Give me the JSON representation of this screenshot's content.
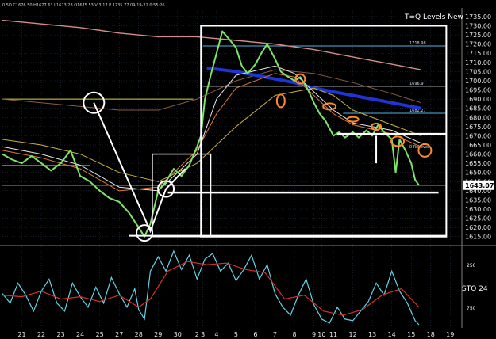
{
  "header": {
    "info": "0.5D  C1676.50 H1677.63 L1673.28 O1675.53 V 3.17 P 1735.77 09-19-22 0:55:26",
    "title": "T=Q Levels New"
  },
  "colors": {
    "background": "#000000",
    "grid": "#26364a",
    "price": "#7fe36b",
    "ma_blue": "#1f33d6",
    "ma_pink": "#d48b8b",
    "ma_brown": "#8a5a45",
    "ma_gold": "#c8b23c",
    "ma_white": "#e8e8e8",
    "ma_orange": "#e07a33",
    "level_cyan": "#4fb6e6",
    "level_yellow": "#d6d64a",
    "level_red": "#d93c3c",
    "sto_fast": "#5fd6e6",
    "sto_slow": "#d83030",
    "annotation": "#ffffff",
    "highlight_circle": "#ff8a2a"
  },
  "chart_data": [
    {
      "type": "line",
      "title": "T=Q Levels New",
      "ylim": [
        1611,
        1738
      ],
      "y_ticks": [
        "1735.00",
        "1730.00",
        "1725.00",
        "1720.00",
        "1715.00",
        "1710.00",
        "1705.00",
        "1700.00",
        "1695.00",
        "1690.00",
        "1685.00",
        "1680.00",
        "1675.00",
        "1670.00",
        "1665.00",
        "1660.00",
        "1655.00",
        "1650.00",
        "1645.00",
        "1640.00",
        "1635.00",
        "1630.00",
        "1625.00",
        "1620.00",
        "1615.00"
      ],
      "x_ticks": [
        "21",
        "22",
        "23",
        "24",
        "25",
        "27",
        "28",
        "29",
        "30",
        "2",
        "3",
        "4",
        "5",
        "6",
        "7",
        "8",
        "9",
        "10",
        "11",
        "12",
        "13",
        "14",
        "15",
        "18",
        "19"
      ],
      "x_tick_positions": [
        21,
        22,
        23,
        24,
        25,
        26,
        27,
        28,
        29,
        30,
        30.3,
        31,
        32,
        33,
        34,
        35,
        36,
        36.4,
        37,
        38,
        39,
        40,
        41,
        42,
        43
      ],
      "last_price_label": "1643.07",
      "level_labels": [
        {
          "text": "1718.98",
          "price": 1718.98
        },
        {
          "text": "1696.9",
          "price": 1696.9
        },
        {
          "text": "1682.27",
          "price": 1682.27
        },
        {
          "text": "0 Rollover",
          "price": 1662.5
        }
      ],
      "series": [
        {
          "key": "price",
          "points": [
            [
              20.0,
              1660
            ],
            [
              20.5,
              1657
            ],
            [
              21.0,
              1655
            ],
            [
              21.5,
              1659
            ],
            [
              22.0,
              1655
            ],
            [
              22.5,
              1651
            ],
            [
              23.0,
              1655
            ],
            [
              23.5,
              1662
            ],
            [
              24.0,
              1648
            ],
            [
              24.5,
              1645
            ],
            [
              25.0,
              1640
            ],
            [
              25.5,
              1636
            ],
            [
              26.0,
              1634
            ],
            [
              26.5,
              1628
            ],
            [
              27.0,
              1620
            ],
            [
              27.3,
              1615
            ],
            [
              27.6,
              1622
            ],
            [
              28.0,
              1640
            ],
            [
              28.4,
              1645
            ],
            [
              28.8,
              1652
            ],
            [
              29.2,
              1648
            ],
            [
              29.6,
              1654
            ],
            [
              30.0,
              1664
            ],
            [
              30.2,
              1670
            ],
            [
              30.4,
              1690
            ],
            [
              30.7,
              1703
            ],
            [
              31.0,
              1715
            ],
            [
              31.3,
              1727
            ],
            [
              31.7,
              1722
            ],
            [
              32.0,
              1718
            ],
            [
              32.3,
              1708
            ],
            [
              32.6,
              1704
            ],
            [
              33.0,
              1709
            ],
            [
              33.3,
              1715
            ],
            [
              33.6,
              1720
            ],
            [
              34.0,
              1712
            ],
            [
              34.3,
              1705
            ],
            [
              34.7,
              1702
            ],
            [
              35.0,
              1700
            ],
            [
              35.3,
              1702
            ],
            [
              35.7,
              1695
            ],
            [
              36.0,
              1688
            ],
            [
              36.3,
              1682
            ],
            [
              36.6,
              1678
            ],
            [
              37.0,
              1670
            ],
            [
              37.3,
              1672
            ],
            [
              37.6,
              1669
            ],
            [
              38.0,
              1672
            ],
            [
              38.3,
              1669
            ],
            [
              38.7,
              1673
            ],
            [
              39.0,
              1670
            ],
            [
              39.3,
              1676
            ],
            [
              39.6,
              1672
            ],
            [
              40.0,
              1668
            ],
            [
              40.2,
              1650
            ],
            [
              40.4,
              1668
            ],
            [
              40.7,
              1662
            ],
            [
              41.0,
              1655
            ],
            [
              41.2,
              1646
            ],
            [
              41.4,
              1643
            ]
          ]
        },
        {
          "key": "ma_blue",
          "points": [
            [
              30.5,
              1707
            ],
            [
              32,
              1705
            ],
            [
              33,
              1703
            ],
            [
              34,
              1701
            ],
            [
              35,
              1699
            ],
            [
              36,
              1696
            ],
            [
              37,
              1694
            ],
            [
              38,
              1692
            ],
            [
              39,
              1690
            ],
            [
              40,
              1688
            ],
            [
              41,
              1686
            ],
            [
              41.5,
              1685
            ]
          ]
        },
        {
          "key": "ma_pink",
          "points": [
            [
              20,
              1733
            ],
            [
              22,
              1731
            ],
            [
              24,
              1729
            ],
            [
              26,
              1726
            ],
            [
              28,
              1724
            ],
            [
              30,
              1724
            ],
            [
              32,
              1722
            ],
            [
              34,
              1720
            ],
            [
              36,
              1717
            ],
            [
              38,
              1713
            ],
            [
              40,
              1709
            ],
            [
              41.5,
              1706
            ]
          ]
        },
        {
          "key": "ma_brown",
          "points": [
            [
              20,
              1690
            ],
            [
              22,
              1688
            ],
            [
              24,
              1686
            ],
            [
              26,
              1684
            ],
            [
              28,
              1684
            ],
            [
              30,
              1690
            ],
            [
              32,
              1700
            ],
            [
              34,
              1706
            ],
            [
              36,
              1704
            ],
            [
              38,
              1699
            ],
            [
              40,
              1693
            ],
            [
              41.5,
              1688
            ]
          ]
        },
        {
          "key": "ma_gold",
          "points": [
            [
              20,
              1668
            ],
            [
              22,
              1665
            ],
            [
              24,
              1660
            ],
            [
              26,
              1650
            ],
            [
              28,
              1645
            ],
            [
              30,
              1655
            ],
            [
              32,
              1675
            ],
            [
              34,
              1692
            ],
            [
              36,
              1696
            ],
            [
              37,
              1692
            ],
            [
              38,
              1684
            ],
            [
              40,
              1676
            ],
            [
              41.5,
              1670
            ]
          ]
        },
        {
          "key": "ma_white",
          "points": [
            [
              20,
              1664
            ],
            [
              22,
              1660
            ],
            [
              24,
              1654
            ],
            [
              26,
              1642
            ],
            [
              28,
              1640
            ],
            [
              30,
              1660
            ],
            [
              31,
              1690
            ],
            [
              32,
              1703
            ],
            [
              34,
              1708
            ],
            [
              35,
              1704
            ],
            [
              36,
              1694
            ],
            [
              37,
              1684
            ],
            [
              38,
              1677
            ],
            [
              40,
              1673
            ],
            [
              41.5,
              1666
            ]
          ]
        },
        {
          "key": "ma_orange",
          "points": [
            [
              20,
              1662
            ],
            [
              22,
              1658
            ],
            [
              24,
              1652
            ],
            [
              26,
              1640
            ],
            [
              28,
              1642
            ],
            [
              30,
              1662
            ],
            [
              31,
              1682
            ],
            [
              32,
              1696
            ],
            [
              34,
              1704
            ],
            [
              35,
              1702
            ],
            [
              36,
              1692
            ],
            [
              37,
              1682
            ],
            [
              38,
              1676
            ],
            [
              40,
              1671
            ],
            [
              41.5,
              1664
            ]
          ]
        }
      ],
      "levels": [
        {
          "color": "level_cyan",
          "price": 1718.98,
          "from": 30.3,
          "to": 42.8
        },
        {
          "color": "level_white",
          "price": 1697,
          "from": 30.3,
          "to": 42.8
        },
        {
          "color": "level_yellow",
          "price": 1690,
          "from": 20,
          "to": 29.8
        },
        {
          "color": "level_cyan",
          "price": 1682.3,
          "from": 37.5,
          "to": 42.8
        },
        {
          "color": "level_red",
          "price": 1654,
          "from": 20,
          "to": 24.5
        },
        {
          "color": "level_yellow",
          "price": 1643,
          "from": 20,
          "to": 42.8
        }
      ]
    },
    {
      "type": "line",
      "ylabel": "STO 24",
      "ylim": [
        0,
        100
      ],
      "y_ticks": [
        "250",
        "750"
      ],
      "x_ticks": [
        "21",
        "22",
        "23",
        "24",
        "25",
        "27",
        "28",
        "29",
        "30",
        "2",
        "3",
        "4",
        "5",
        "6",
        "7",
        "8",
        "9",
        "10",
        "11",
        "12",
        "13",
        "14",
        "15",
        "18",
        "19"
      ],
      "series": [
        {
          "key": "sto_fast",
          "points": [
            [
              20,
              42
            ],
            [
              20.4,
              30
            ],
            [
              20.8,
              55
            ],
            [
              21.2,
              40
            ],
            [
              21.6,
              20
            ],
            [
              22,
              45
            ],
            [
              22.4,
              60
            ],
            [
              22.8,
              30
            ],
            [
              23.2,
              20
            ],
            [
              23.6,
              55
            ],
            [
              24,
              38
            ],
            [
              24.4,
              25
            ],
            [
              24.8,
              50
            ],
            [
              25.2,
              30
            ],
            [
              25.6,
              62
            ],
            [
              26,
              42
            ],
            [
              26.4,
              25
            ],
            [
              26.8,
              48
            ],
            [
              27,
              22
            ],
            [
              27.3,
              10
            ],
            [
              27.6,
              70
            ],
            [
              28,
              88
            ],
            [
              28.4,
              70
            ],
            [
              28.8,
              95
            ],
            [
              29.2,
              72
            ],
            [
              29.6,
              90
            ],
            [
              30,
              60
            ],
            [
              30.4,
              85
            ],
            [
              30.8,
              92
            ],
            [
              31.2,
              70
            ],
            [
              31.6,
              80
            ],
            [
              32,
              58
            ],
            [
              32.4,
              72
            ],
            [
              32.8,
              90
            ],
            [
              33.2,
              60
            ],
            [
              33.6,
              78
            ],
            [
              34,
              42
            ],
            [
              34.4,
              25
            ],
            [
              34.8,
              15
            ],
            [
              35.2,
              40
            ],
            [
              35.6,
              60
            ],
            [
              36,
              28
            ],
            [
              36.4,
              10
            ],
            [
              36.8,
              5
            ],
            [
              37.2,
              25
            ],
            [
              37.6,
              10
            ],
            [
              38,
              8
            ],
            [
              38.4,
              20
            ],
            [
              38.8,
              32
            ],
            [
              39.2,
              55
            ],
            [
              39.6,
              40
            ],
            [
              40,
              70
            ],
            [
              40.4,
              45
            ],
            [
              40.8,
              30
            ],
            [
              41.2,
              8
            ],
            [
              41.4,
              3
            ]
          ]
        },
        {
          "key": "sto_slow",
          "points": [
            [
              20,
              40
            ],
            [
              21,
              38
            ],
            [
              22,
              45
            ],
            [
              23,
              35
            ],
            [
              24,
              38
            ],
            [
              25,
              32
            ],
            [
              26,
              40
            ],
            [
              27,
              25
            ],
            [
              27.6,
              35
            ],
            [
              28.5,
              70
            ],
            [
              29.5,
              82
            ],
            [
              30.5,
              78
            ],
            [
              31.5,
              80
            ],
            [
              32.5,
              72
            ],
            [
              33.5,
              68
            ],
            [
              34.5,
              35
            ],
            [
              35.5,
              40
            ],
            [
              36.5,
              20
            ],
            [
              37.5,
              15
            ],
            [
              38.5,
              22
            ],
            [
              39.5,
              40
            ],
            [
              40.5,
              48
            ],
            [
              41.4,
              25
            ]
          ]
        }
      ]
    }
  ]
}
